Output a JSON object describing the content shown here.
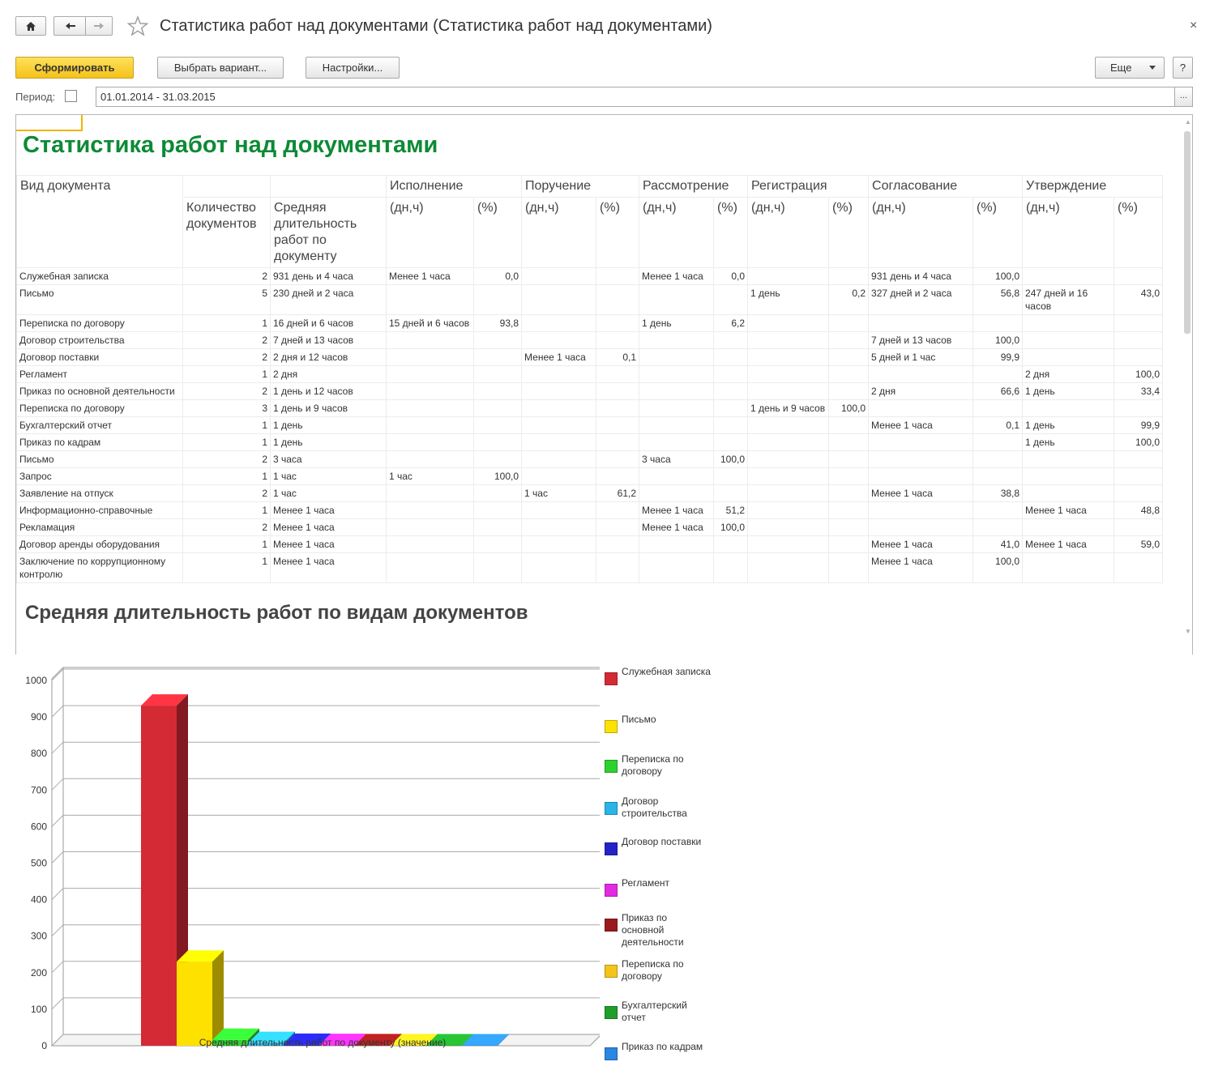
{
  "window": {
    "title": "Статистика работ над документами (Статистика работ над документами)",
    "close": "×"
  },
  "toolbar": {
    "generate": "Сформировать",
    "choose_variant": "Выбрать вариант...",
    "settings": "Настройки...",
    "more": "Еще",
    "help": "?"
  },
  "period": {
    "label": "Период:",
    "value": "01.01.2014 - 31.03.2015",
    "select_btn": "..."
  },
  "report": {
    "title": "Статистика работ над документами",
    "chart_title": "Средняя длительность работ по видам документов",
    "group_headers": [
      "Вид документа",
      "",
      "",
      "Исполнение",
      "",
      "Поручение",
      "",
      "Рассмотрение",
      "",
      "Регистрация",
      "",
      "Согласование",
      "",
      "Утверждение",
      ""
    ],
    "sub_headers": [
      "",
      "Количество документов",
      "Средняя длительность работ по документу",
      "(дн,ч)",
      "(%)",
      "(дн,ч)",
      "(%)",
      "(дн,ч)",
      "(%)",
      "(дн,ч)",
      "(%)",
      "(дн,ч)",
      "(%)",
      "(дн,ч)",
      "(%)"
    ],
    "rows": [
      [
        "Служебная записка",
        "2",
        "931 день и 4 часа",
        "Менее 1 часа",
        "0,0",
        "",
        "",
        "Менее 1 часа",
        "0,0",
        "",
        "",
        "931 день и 4 часа",
        "100,0",
        "",
        ""
      ],
      [
        "Письмо",
        "5",
        "230 дней и 2 часа",
        "",
        "",
        "",
        "",
        "",
        "",
        "1 день",
        "0,2",
        "327 дней и 2 часа",
        "56,8",
        "247 дней и 16 часов",
        "43,0"
      ],
      [
        "Переписка по договору",
        "1",
        "16 дней и 6 часов",
        "15 дней и 6 часов",
        "93,8",
        "",
        "",
        "1 день",
        "6,2",
        "",
        "",
        "",
        "",
        "",
        ""
      ],
      [
        "Договор строительства",
        "2",
        "7 дней и 13 часов",
        "",
        "",
        "",
        "",
        "",
        "",
        "",
        "",
        "7 дней и 13 часов",
        "100,0",
        "",
        ""
      ],
      [
        "Договор поставки",
        "2",
        "2 дня и 12 часов",
        "",
        "",
        "Менее 1 часа",
        "0,1",
        "",
        "",
        "",
        "",
        "5 дней и 1 час",
        "99,9",
        "",
        ""
      ],
      [
        "Регламент",
        "1",
        "2 дня",
        "",
        "",
        "",
        "",
        "",
        "",
        "",
        "",
        "",
        "",
        "2 дня",
        "100,0"
      ],
      [
        "Приказ по основной деятельности",
        "2",
        "1 день и 12 часов",
        "",
        "",
        "",
        "",
        "",
        "",
        "",
        "",
        "2 дня",
        "66,6",
        "1 день",
        "33,4"
      ],
      [
        "Переписка по договору",
        "3",
        "1 день и 9 часов",
        "",
        "",
        "",
        "",
        "",
        "",
        "1 день и 9 часов",
        "100,0",
        "",
        "",
        "",
        ""
      ],
      [
        "Бухгалтерский отчет",
        "1",
        "1 день",
        "",
        "",
        "",
        "",
        "",
        "",
        "",
        "",
        "Менее 1 часа",
        "0,1",
        "1 день",
        "99,9"
      ],
      [
        "Приказ по кадрам",
        "1",
        "1 день",
        "",
        "",
        "",
        "",
        "",
        "",
        "",
        "",
        "",
        "",
        "1 день",
        "100,0"
      ],
      [
        "Письмо",
        "2",
        "3 часа",
        "",
        "",
        "",
        "",
        "3 часа",
        "100,0",
        "",
        "",
        "",
        "",
        "",
        ""
      ],
      [
        "Запрос",
        "1",
        "1 час",
        "1 час",
        "100,0",
        "",
        "",
        "",
        "",
        "",
        "",
        "",
        "",
        "",
        ""
      ],
      [
        "Заявление на отпуск",
        "2",
        "1 час",
        "",
        "",
        "1 час",
        "61,2",
        "",
        "",
        "",
        "",
        "Менее 1 часа",
        "38,8",
        "",
        ""
      ],
      [
        "Информационно-справочные",
        "1",
        "Менее 1 часа",
        "",
        "",
        "",
        "",
        "Менее 1 часа",
        "51,2",
        "",
        "",
        "",
        "",
        "Менее 1 часа",
        "48,8"
      ],
      [
        "Рекламация",
        "2",
        "Менее 1 часа",
        "",
        "",
        "",
        "",
        "Менее 1 часа",
        "100,0",
        "",
        "",
        "",
        "",
        "",
        ""
      ],
      [
        "Договор аренды оборудования",
        "1",
        "Менее 1 часа",
        "",
        "",
        "",
        "",
        "",
        "",
        "",
        "",
        "Менее 1 часа",
        "41,0",
        "Менее 1 часа",
        "59,0"
      ],
      [
        "Заключение по коррупционному контролю",
        "1",
        "Менее 1 часа",
        "",
        "",
        "",
        "",
        "",
        "",
        "",
        "",
        "Менее 1 часа",
        "100,0",
        "",
        ""
      ]
    ]
  },
  "chart_data": {
    "type": "bar",
    "xlabel": "Средняя длительность работ по документу  (значение)",
    "ylim": [
      0,
      1000
    ],
    "yticks": [
      0,
      100,
      200,
      300,
      400,
      500,
      600,
      700,
      800,
      900,
      1000
    ],
    "series": [
      {
        "name": "Служебная записка",
        "value": 931,
        "color": "#d42a36"
      },
      {
        "name": "Письмо",
        "value": 230,
        "color": "#ffe100"
      },
      {
        "name": "Переписка по договору",
        "value": 16,
        "color": "#2ed12e"
      },
      {
        "name": "Договор строительства",
        "value": 7.5,
        "color": "#2ab4e8"
      },
      {
        "name": "Договор поставки",
        "value": 2.5,
        "color": "#2323c8"
      },
      {
        "name": "Регламент",
        "value": 2,
        "color": "#e12ae1"
      },
      {
        "name": "Приказ по основной деятельности",
        "value": 1.5,
        "color": "#9a1b1b"
      },
      {
        "name": "Переписка по договору",
        "value": 1.4,
        "color": "#f5c41a"
      },
      {
        "name": "Бухгалтерский отчет",
        "value": 1,
        "color": "#1f9e2a"
      },
      {
        "name": "Приказ по кадрам",
        "value": 1,
        "color": "#2a86e0"
      }
    ],
    "legend_labels": [
      "Служебная записка",
      "Письмо",
      "Переписка по договору",
      "Договор строительства",
      "Договор поставки",
      "Регламент",
      "Приказ по основной деятельности",
      "Переписка по договору",
      "Бухгалтерский отчет",
      "Приказ по кадрам"
    ],
    "legend_position": "right",
    "grid": true
  }
}
